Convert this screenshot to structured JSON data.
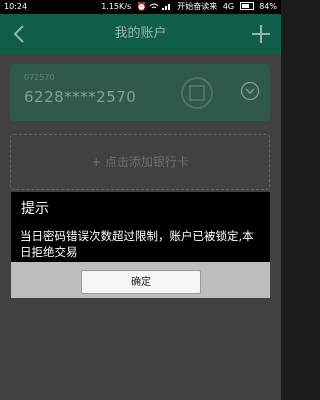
{
  "status_bar": {
    "time": "10:24",
    "speed": "1.15K/s",
    "carrier": "开始奋读来",
    "network": "4G",
    "battery": "84%",
    "icons": [
      "alarm-icon",
      "wifi-icon",
      "signal-icon",
      "battery-icon"
    ]
  },
  "header": {
    "title": "我的账户",
    "back_icon": "chevron-left-icon",
    "add_icon": "plus-icon"
  },
  "card": {
    "label": "072570",
    "number": "6228****2570",
    "expand_icon": "chevron-down-circle-icon"
  },
  "add_card": {
    "label": "+ 点击添加银行卡"
  },
  "dialog": {
    "title": "提示",
    "message": "当日密码错误次数超过限制，账户已被锁定,本日拒绝交易",
    "ok_label": "确定"
  },
  "colors": {
    "header_bg": "#0f5e49",
    "card_bg": "#2f5a49",
    "overlay_bg": "#414141",
    "dialog_bg": "#000000",
    "dialog_footer": "#bdbdbd"
  }
}
